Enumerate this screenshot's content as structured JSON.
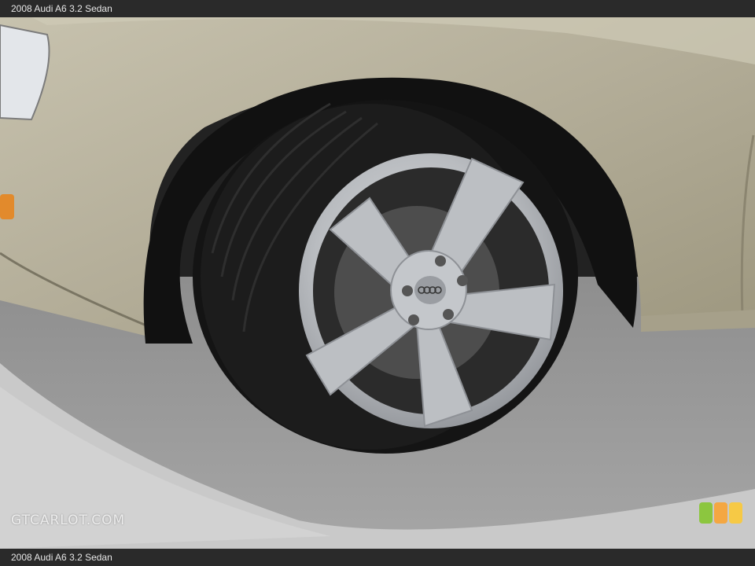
{
  "header": {
    "caption": "2008 Audi A6 3.2 Sedan"
  },
  "footer": {
    "caption": "2008 Audi A6 3.2 Sedan"
  },
  "watermark": {
    "text": "GTCARLOT.COM"
  },
  "photo": {
    "subject": "car-wheel",
    "car_color": "#b3ad98",
    "road_color": "#9a9a9a"
  },
  "badge_colors": [
    "#8cc63f",
    "#f4a742",
    "#f6c945"
  ]
}
